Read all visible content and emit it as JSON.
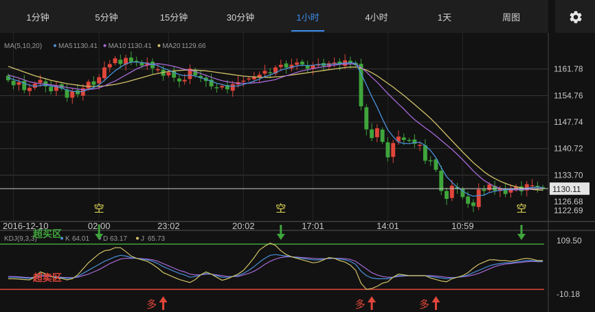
{
  "tabs": [
    {
      "label": "1分钟"
    },
    {
      "label": "5分钟"
    },
    {
      "label": "15分钟"
    },
    {
      "label": "30分钟"
    },
    {
      "label": "1小时",
      "active": true
    },
    {
      "label": "4小时"
    },
    {
      "label": "1天"
    },
    {
      "label": "周图"
    }
  ],
  "settings_icon": "gear-icon",
  "colors": {
    "up": "#e0463a",
    "down": "#3fa43c",
    "ma5": "#4a90d9",
    "ma10": "#a86ad8",
    "ma20": "#d4c46a",
    "k": "#4a90d9",
    "d": "#a86ad8",
    "j": "#d4c46a",
    "overbought": "#3fa43c",
    "oversold": "#e0463a",
    "signal_short": "#e8e05a",
    "signal_long": "#e0463a"
  },
  "chart_data": [
    {
      "type": "candlestick",
      "indicator_label": "MA(5,10,20)",
      "legend": [
        {
          "name": "MA5",
          "value": "1130.41"
        },
        {
          "name": "MA10",
          "value": "1130.41"
        },
        {
          "name": "MA20",
          "value": "1129.66"
        }
      ],
      "y_ticks": [
        "1161.78",
        "1154.76",
        "1147.74",
        "1140.72",
        "1133.70",
        "1126.68",
        "1122.69"
      ],
      "ylim": [
        1122.69,
        1168.8
      ],
      "current_price": "1130.11",
      "x_ticks": [
        "2016-12-10",
        "02:00",
        "23:02",
        "20:02",
        "17:01",
        "14:01",
        "10:59"
      ],
      "close": [
        1158.8,
        1157.5,
        1158.3,
        1156.2,
        1156.8,
        1157.9,
        1158.9,
        1157.2,
        1155.9,
        1157.4,
        1156.6,
        1154.2,
        1155.9,
        1155.1,
        1156.7,
        1158.4,
        1157.6,
        1159.6,
        1162.2,
        1163.1,
        1164.6,
        1163.1,
        1164.7,
        1163.6,
        1163.8,
        1162.7,
        1163.5,
        1162.0,
        1161.7,
        1160.0,
        1160.9,
        1159.5,
        1158.5,
        1158.9,
        1161.9,
        1160.1,
        1159.4,
        1158.6,
        1157.2,
        1156.9,
        1157.3,
        1156.4,
        1157.8,
        1158.3,
        1158.7,
        1159.3,
        1159.7,
        1160.3,
        1161.3,
        1160.7,
        1162.2,
        1162.9,
        1162.2,
        1162.9,
        1163.5,
        1163.0,
        1161.9,
        1162.8,
        1163.0,
        1162.6,
        1163.3,
        1163.5,
        1163.0,
        1164.1,
        1163.3,
        1162.8,
        1151.9,
        1145.8,
        1143.5,
        1146.1,
        1142.5,
        1138.4,
        1142.2,
        1143.9,
        1143.0,
        1142.9,
        1142.0,
        1141.7,
        1137.5,
        1137.5,
        1135.1,
        1129.5,
        1127.4,
        1130.9,
        1130.1,
        1127.9,
        1126.1,
        1125.5,
        1129.9,
        1129.5,
        1131.2,
        1129.6,
        1130.0,
        1128.7,
        1130.1,
        1130.7,
        1129.4,
        1131.3,
        1131.0,
        1130.4,
        1130.1
      ],
      "ma5": [
        1159.5,
        1159.0,
        1158.6,
        1158.0,
        1157.5,
        1157.2,
        1157.4,
        1157.6,
        1157.3,
        1157.1,
        1156.8,
        1156.2,
        1155.9,
        1155.8,
        1155.8,
        1156.4,
        1156.9,
        1157.6,
        1158.8,
        1160.1,
        1161.3,
        1162.3,
        1163.1,
        1163.6,
        1163.6,
        1163.5,
        1163.3,
        1163.0,
        1162.7,
        1162.0,
        1161.5,
        1160.9,
        1160.3,
        1160.0,
        1160.2,
        1159.9,
        1159.5,
        1159.0,
        1158.6,
        1158.0,
        1157.7,
        1157.3,
        1157.2,
        1157.3,
        1157.7,
        1158.1,
        1158.6,
        1159.1,
        1159.8,
        1160.2,
        1160.8,
        1161.5,
        1161.9,
        1162.3,
        1162.6,
        1162.8,
        1162.7,
        1162.8,
        1163.0,
        1163.0,
        1163.0,
        1163.1,
        1163.2,
        1163.4,
        1163.4,
        1163.3,
        1160.6,
        1157.6,
        1154.5,
        1151.7,
        1148.6,
        1145.7,
        1143.9,
        1142.4,
        1142.1,
        1142.0,
        1142.3,
        1142.4,
        1141.5,
        1140.2,
        1138.3,
        1135.7,
        1133.3,
        1131.8,
        1130.5,
        1129.5,
        1128.6,
        1128.1,
        1128.3,
        1128.4,
        1129.1,
        1129.4,
        1129.7,
        1129.8,
        1130.0,
        1130.1,
        1130.0,
        1130.3,
        1130.4,
        1130.5,
        1130.4
      ],
      "ma10": [
        1160.2,
        1159.8,
        1159.4,
        1158.9,
        1158.4,
        1158.1,
        1157.9,
        1157.8,
        1157.6,
        1157.4,
        1157.2,
        1156.9,
        1156.7,
        1156.5,
        1156.3,
        1156.4,
        1156.5,
        1156.8,
        1157.3,
        1158.0,
        1158.6,
        1159.4,
        1160.2,
        1161.0,
        1161.8,
        1162.4,
        1162.8,
        1163.1,
        1163.2,
        1163.0,
        1162.8,
        1162.5,
        1162.1,
        1161.7,
        1161.5,
        1161.1,
        1160.6,
        1160.1,
        1159.6,
        1159.1,
        1158.7,
        1158.4,
        1158.2,
        1158.0,
        1158.0,
        1158.0,
        1158.1,
        1158.2,
        1158.5,
        1158.7,
        1159.0,
        1159.5,
        1160.0,
        1160.4,
        1160.9,
        1161.3,
        1161.6,
        1161.9,
        1162.2,
        1162.4,
        1162.6,
        1162.8,
        1163.0,
        1163.1,
        1163.1,
        1163.1,
        1162.2,
        1161.0,
        1159.6,
        1158.3,
        1156.8,
        1155.3,
        1153.9,
        1152.5,
        1151.2,
        1149.7,
        1148.4,
        1147.3,
        1146.2,
        1145.2,
        1144.1,
        1142.9,
        1141.7,
        1140.5,
        1139.2,
        1137.8,
        1136.3,
        1134.8,
        1133.5,
        1132.3,
        1131.4,
        1130.7,
        1130.2,
        1129.9,
        1129.8,
        1129.8,
        1129.8,
        1129.9,
        1130.0,
        1130.1,
        1130.2
      ],
      "ma20": [
        1162.5,
        1162.0,
        1161.5,
        1161.0,
        1160.5,
        1160.0,
        1159.6,
        1159.2,
        1158.8,
        1158.5,
        1158.2,
        1157.9,
        1157.7,
        1157.5,
        1157.3,
        1157.2,
        1157.2,
        1157.2,
        1157.3,
        1157.5,
        1157.7,
        1158.0,
        1158.3,
        1158.7,
        1159.1,
        1159.5,
        1159.9,
        1160.3,
        1160.6,
        1160.9,
        1161.1,
        1161.3,
        1161.4,
        1161.5,
        1161.5,
        1161.5,
        1161.4,
        1161.3,
        1161.1,
        1160.9,
        1160.7,
        1160.5,
        1160.3,
        1160.1,
        1159.9,
        1159.8,
        1159.7,
        1159.6,
        1159.6,
        1159.6,
        1159.7,
        1159.8,
        1160.0,
        1160.2,
        1160.4,
        1160.6,
        1160.8,
        1161.0,
        1161.2,
        1161.4,
        1161.6,
        1161.8,
        1162.0,
        1162.2,
        1162.3,
        1162.3,
        1162.0,
        1161.5,
        1160.8,
        1160.0,
        1159.0,
        1158.0,
        1157.0,
        1155.9,
        1154.8,
        1153.6,
        1152.4,
        1151.2,
        1150.0,
        1148.7,
        1147.3,
        1145.8,
        1144.3,
        1142.8,
        1141.3,
        1139.8,
        1138.4,
        1137.0,
        1135.8,
        1134.6,
        1133.6,
        1132.8,
        1132.1,
        1131.5,
        1131.0,
        1130.6,
        1130.3,
        1130.1,
        1129.9,
        1129.8,
        1129.7
      ]
    },
    {
      "type": "line",
      "indicator_label": "KDJ(9,3,3)",
      "legend": [
        {
          "name": "K",
          "value": "64.01"
        },
        {
          "name": "D",
          "value": "63.17"
        },
        {
          "name": "J",
          "value": "65.73"
        }
      ],
      "y_ticks": [
        "109.50",
        "-10.18"
      ],
      "ylim": [
        -10.18,
        109.5
      ],
      "overbought_label": "超买区",
      "oversold_label": "超卖区",
      "k": [
        22,
        22,
        21,
        20,
        19,
        22,
        28,
        27,
        24,
        22,
        21,
        19,
        20,
        24,
        32,
        40,
        48,
        56,
        64,
        70,
        76,
        80,
        78,
        74,
        72,
        70,
        68,
        64,
        58,
        50,
        44,
        38,
        32,
        28,
        22,
        24,
        28,
        32,
        30,
        26,
        22,
        22,
        24,
        26,
        32,
        40,
        50,
        62,
        72,
        80,
        82,
        80,
        78,
        76,
        74,
        72,
        70,
        68,
        68,
        70,
        72,
        72,
        70,
        68,
        64,
        56,
        38,
        26,
        20,
        18,
        18,
        18,
        22,
        26,
        26,
        26,
        26,
        26,
        26,
        24,
        22,
        20,
        18,
        20,
        22,
        24,
        28,
        34,
        40,
        46,
        52,
        56,
        58,
        60,
        60,
        62,
        64,
        66,
        66,
        64,
        64
      ],
      "d": [
        24,
        24,
        23,
        22,
        21,
        22,
        24,
        25,
        24,
        23,
        22,
        21,
        21,
        22,
        26,
        30,
        36,
        42,
        50,
        58,
        64,
        70,
        72,
        72,
        72,
        71,
        70,
        68,
        64,
        58,
        52,
        46,
        40,
        36,
        30,
        28,
        28,
        30,
        30,
        28,
        26,
        24,
        24,
        24,
        28,
        32,
        38,
        46,
        56,
        64,
        70,
        74,
        76,
        76,
        75,
        74,
        73,
        72,
        71,
        71,
        71,
        72,
        72,
        71,
        69,
        64,
        54,
        44,
        34,
        28,
        24,
        22,
        22,
        24,
        25,
        26,
        26,
        26,
        26,
        26,
        25,
        24,
        22,
        21,
        22,
        23,
        25,
        28,
        32,
        38,
        44,
        50,
        54,
        57,
        58,
        60,
        61,
        63,
        64,
        63,
        63
      ],
      "j": [
        18,
        18,
        17,
        16,
        15,
        22,
        36,
        31,
        24,
        20,
        19,
        15,
        18,
        28,
        44,
        60,
        72,
        84,
        92,
        94,
        100,
        100,
        90,
        78,
        72,
        68,
        64,
        56,
        46,
        34,
        28,
        22,
        16,
        12,
        8,
        16,
        28,
        36,
        30,
        22,
        14,
        18,
        24,
        30,
        40,
        56,
        74,
        94,
        104,
        112,
        106,
        92,
        82,
        76,
        72,
        68,
        64,
        60,
        62,
        68,
        74,
        72,
        66,
        62,
        54,
        40,
        6,
        -10,
        -8,
        -2,
        6,
        10,
        22,
        30,
        28,
        26,
        26,
        26,
        26,
        20,
        16,
        12,
        10,
        18,
        22,
        26,
        34,
        46,
        56,
        62,
        68,
        68,
        66,
        66,
        64,
        66,
        70,
        72,
        70,
        66,
        66
      ]
    }
  ],
  "signals": [
    {
      "type": "short",
      "label": "空",
      "index": 17
    },
    {
      "type": "short",
      "label": "空",
      "index": 51
    },
    {
      "type": "short",
      "label": "空",
      "index": 96
    },
    {
      "type": "long",
      "label": "多",
      "index": 29
    },
    {
      "type": "long",
      "label": "多",
      "index": 68
    },
    {
      "type": "long",
      "label": "多",
      "index": 80
    }
  ]
}
